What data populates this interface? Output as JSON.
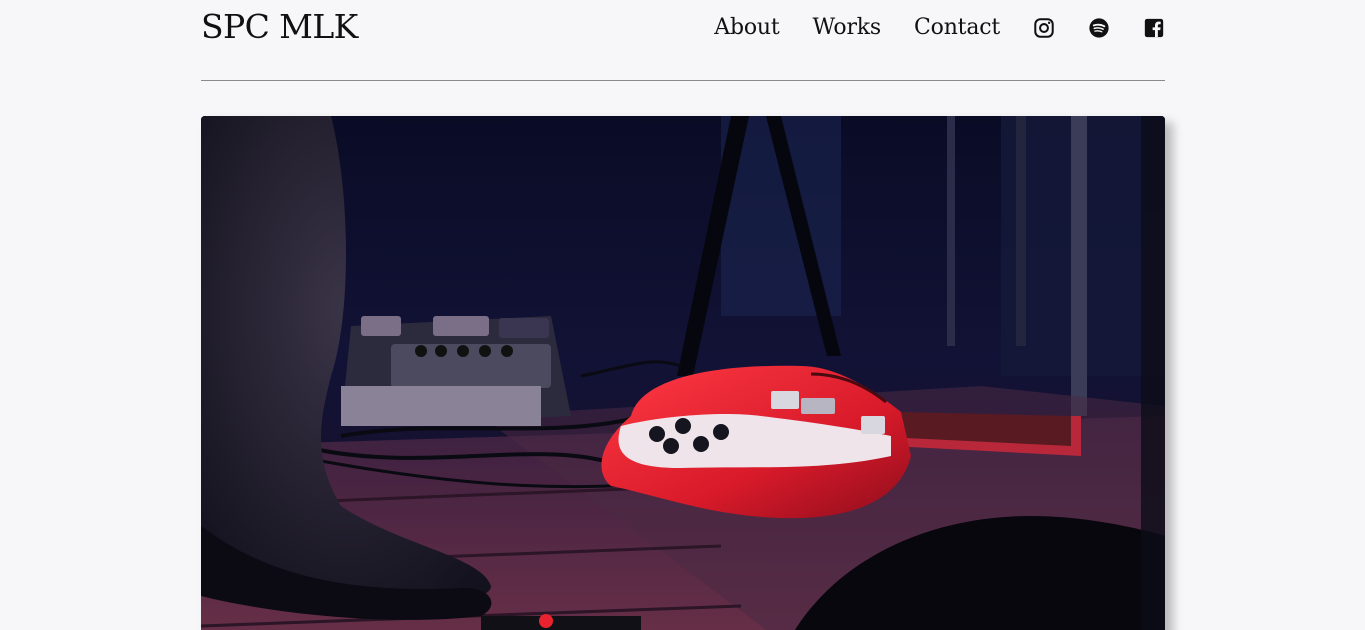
{
  "header": {
    "brand": "SPC MLK",
    "nav": [
      {
        "label": "About"
      },
      {
        "label": "Works"
      },
      {
        "label": "Contact"
      }
    ],
    "social": [
      {
        "icon": "instagram-icon"
      },
      {
        "icon": "spotify-icon"
      },
      {
        "icon": "facebook-icon"
      }
    ]
  },
  "hero": {
    "subject": "red-electric-guitar-on-stage-photo",
    "colors": {
      "background": "#0c0d22",
      "guitar": "#e8232f",
      "floor": "#6a2f4a"
    }
  }
}
